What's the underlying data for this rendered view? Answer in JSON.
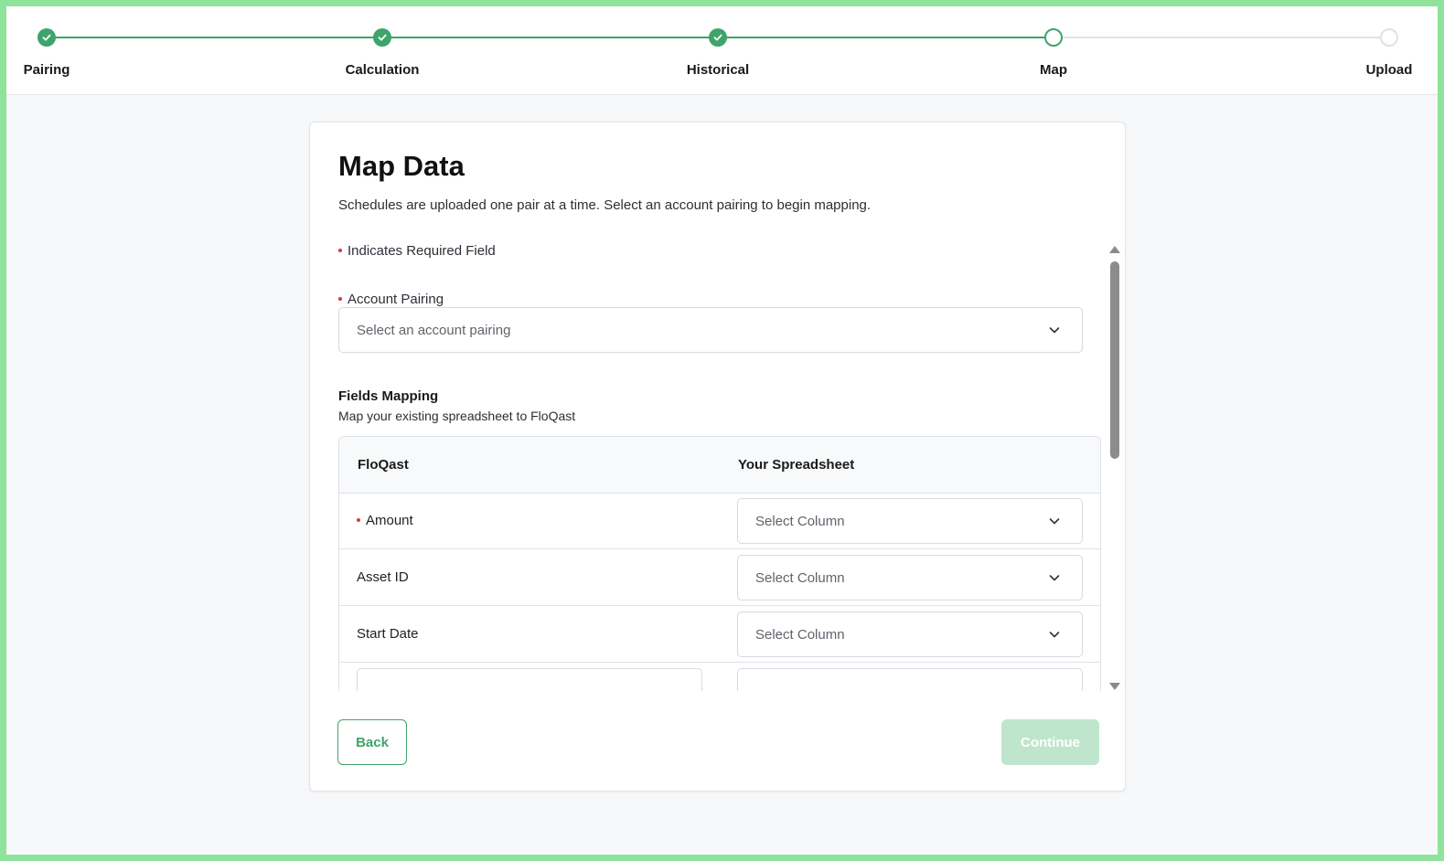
{
  "stepper": {
    "steps": [
      {
        "label": "Pairing",
        "state": "done"
      },
      {
        "label": "Calculation",
        "state": "done"
      },
      {
        "label": "Historical",
        "state": "done"
      },
      {
        "label": "Map",
        "state": "current"
      },
      {
        "label": "Upload",
        "state": "todo"
      }
    ]
  },
  "page": {
    "title": "Map Data",
    "subtitle": "Schedules are uploaded one pair at a time. Select an account pairing to begin mapping.",
    "required_legend": "Indicates Required Field"
  },
  "account_pairing": {
    "label": "Account Pairing",
    "placeholder": "Select an account pairing"
  },
  "fields_mapping": {
    "title": "Fields Mapping",
    "subtitle": "Map your existing spreadsheet to FloQast",
    "columns": [
      "FloQast",
      "Your Spreadsheet"
    ],
    "rows": [
      {
        "field": "Amount",
        "required": true,
        "placeholder": "Select Column"
      },
      {
        "field": "Asset ID",
        "required": false,
        "placeholder": "Select Column"
      },
      {
        "field": "Start Date",
        "required": false,
        "placeholder": "Select Column"
      }
    ]
  },
  "actions": {
    "back_label": "Back",
    "continue_label": "Continue"
  },
  "colors": {
    "accent": "#3ea46b",
    "required": "#d33c3c",
    "continue_disabled": "#bfe6cc",
    "frame": "#8fe39a"
  },
  "icons": {
    "step_done": "check-icon",
    "dropdown": "chevron-down-icon"
  }
}
